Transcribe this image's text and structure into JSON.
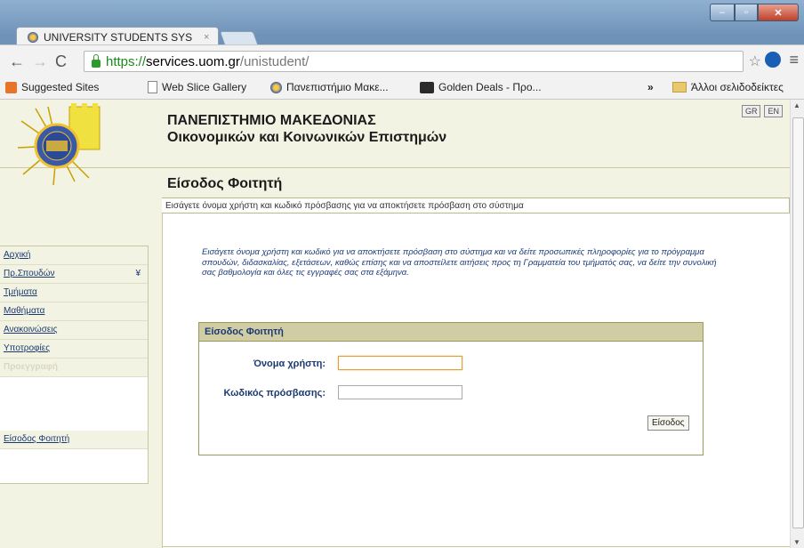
{
  "browser": {
    "tab_title": "UNIVERSITY STUDENTS SYS",
    "tab_close": "×",
    "url_scheme": "https://",
    "url_host": "services.uom.gr",
    "url_path": "/unistudent/",
    "bookmarks": [
      {
        "label": "Suggested Sites",
        "icon": "suggested-sites-icon"
      },
      {
        "label": "Web Slice Gallery",
        "icon": "page-icon"
      },
      {
        "label": "Πανεπιστήμιο Μακε...",
        "icon": "uom-favicon"
      },
      {
        "label": "Golden Deals - Προ...",
        "icon": "golden-deals-icon"
      }
    ],
    "more_bookmarks": "»",
    "other_bookmarks": "Άλλοι σελιδοδείκτες"
  },
  "header": {
    "university_line1": "ΠΑΝΕΠΙΣΤΗΜΙΟ ΜΑΚΕΔΟΝΙΑΣ",
    "university_line2": "Οικονομικών και Κοινωνικών Επιστημών",
    "lang_gr": "GR",
    "lang_en": "EN"
  },
  "page": {
    "title": "Είσοδος Φοιτητή",
    "instruction": "Εισάγετε όνομα χρήστη και κωδικό πρόσβασης για να αποκτήσετε πρόσβαση στο σύστημα",
    "intro": "Εισάγετε όνομα χρήστη και κωδικό για να αποκτήσετε πρόσβαση στο σύστημα και να δείτε προσωπικές πληροφορίες για το πρόγραμμα σπουδών, διδασκαλίας, εξετάσεων, καθώς επίσης και να αποστείλετε αιτήσεις προς τη Γραμματεία του τμήματός σας, να δείτε την συνολική σας βαθμολογία και όλες τις εγγραφές σας στα εξάμηνα."
  },
  "sidebar": {
    "items": [
      {
        "label": "Αρχική"
      },
      {
        "label": "Πρ.Σπουδών",
        "arrow": "¥"
      },
      {
        "label": "Τμήματα"
      },
      {
        "label": "Μαθήματα"
      },
      {
        "label": "Ανακοινώσεις"
      },
      {
        "label": "Υποτροφίες"
      },
      {
        "label": "Προεγγραφή"
      }
    ],
    "login_link": "Είσοδος Φοιτητή"
  },
  "login": {
    "header": "Είσοδος Φοιτητή",
    "username_label": "Όνομα χρήστη:",
    "password_label": "Κωδικός πρόσβασης:",
    "username_value": "",
    "password_value": "",
    "submit_label": "Είσοδος"
  }
}
